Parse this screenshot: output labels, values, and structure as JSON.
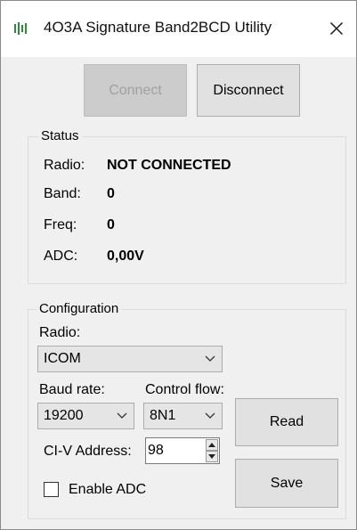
{
  "window": {
    "title": "4O3A Signature Band2BCD Utility"
  },
  "buttons": {
    "connect": "Connect",
    "disconnect": "Disconnect",
    "read": "Read",
    "save": "Save"
  },
  "status": {
    "legend": "Status",
    "rows": [
      {
        "label": "Radio:",
        "value": "NOT CONNECTED"
      },
      {
        "label": "Band:",
        "value": "0"
      },
      {
        "label": "Freq:",
        "value": "0"
      },
      {
        "label": "ADC:",
        "value": "0,00V"
      }
    ]
  },
  "configuration": {
    "legend": "Configuration",
    "radio_label": "Radio:",
    "radio_value": "ICOM",
    "baud_label": "Baud rate:",
    "baud_value": "19200",
    "flow_label": "Control flow:",
    "flow_value": "8N1",
    "civ_label": "CI-V Address:",
    "civ_value": "98",
    "enable_adc_label": "Enable ADC",
    "enable_adc_checked": false
  },
  "colors": {
    "accent_icon": "#2e8b3a",
    "disabled_text": "#a0a0a0"
  }
}
